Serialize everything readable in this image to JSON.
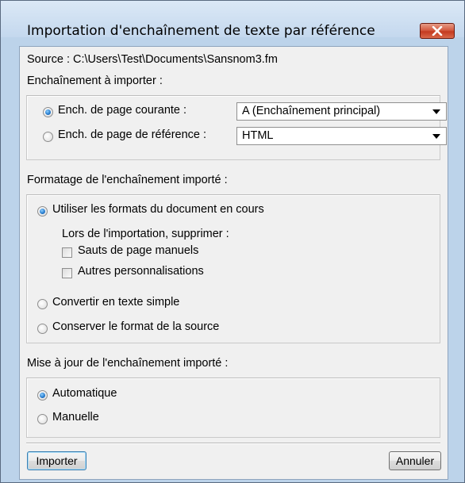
{
  "window": {
    "title": "Importation d'enchaînement de texte par référence",
    "close_icon": "close-icon"
  },
  "source": {
    "label": "Source :",
    "path": "C:\\Users\\Test\\Documents\\Sansnom3.fm"
  },
  "flow_section": {
    "heading": "Enchaînement à importer :",
    "options": [
      {
        "label": "Ench. de page courante :",
        "selected": true,
        "combo_value": "A (Enchaînement principal)"
      },
      {
        "label": "Ench. de page de référence :",
        "selected": false,
        "combo_value": "HTML"
      }
    ]
  },
  "format_section": {
    "heading": "Formatage de l'enchaînement importé :",
    "use_doc_formats": {
      "label": "Utiliser les formats du document en cours",
      "selected": true
    },
    "remove_label": "Lors de l'importation, supprimer :",
    "checkboxes": [
      {
        "label": "Sauts de page manuels",
        "checked": false
      },
      {
        "label": "Autres personnalisations",
        "checked": false
      }
    ],
    "plain_text": {
      "label": "Convertir en texte simple",
      "selected": false
    },
    "keep_source": {
      "label": "Conserver le format de la source",
      "selected": false
    }
  },
  "update_section": {
    "heading": "Mise à jour de l'enchaînement importé :",
    "options": [
      {
        "label": "Automatique",
        "selected": true
      },
      {
        "label": "Manuelle",
        "selected": false
      }
    ]
  },
  "buttons": {
    "import": "Importer",
    "cancel": "Annuler"
  },
  "colors": {
    "frame": "#bcd3ea",
    "client": "#f0f0f0",
    "close": "#c43a20",
    "radio_selected": "#2a7fd0"
  }
}
